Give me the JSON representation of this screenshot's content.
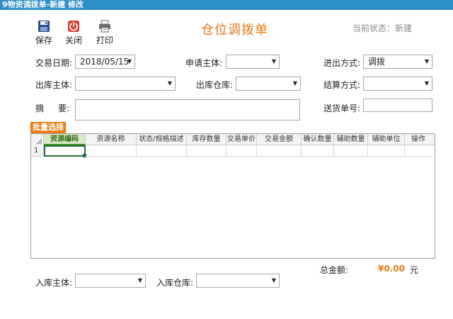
{
  "window": {
    "title": "9物资调拨单-新建 修改"
  },
  "toolbar": {
    "save_label": "保存",
    "close_label": "关闭",
    "print_label": "打印",
    "colors": {
      "save": "#2b4f8f",
      "close": "#e03c2c",
      "print": "#6b6b6b"
    }
  },
  "page": {
    "title": "仓位调拨单"
  },
  "status": {
    "label": "当前状态：",
    "value": "新建"
  },
  "form": {
    "trade_date": {
      "label": "交易日期:",
      "value": "2018/05/15"
    },
    "applicant": {
      "label": "申请主体:",
      "value": ""
    },
    "io_method": {
      "label": "进出方式:",
      "value": "调拨"
    },
    "out_entity": {
      "label": "出库主体:",
      "value": ""
    },
    "out_warehouse": {
      "label": "出库仓库:",
      "value": ""
    },
    "settle_method": {
      "label": "结算方式:",
      "value": ""
    },
    "summary": {
      "label_a": "摘",
      "label_b": "要:",
      "value": ""
    },
    "delivery_no": {
      "label": "送货单号:",
      "value": ""
    },
    "in_entity": {
      "label": "入库主体:",
      "value": ""
    },
    "in_warehouse": {
      "label": "入库仓库:",
      "value": ""
    }
  },
  "batch": {
    "tab_label": "批量选择"
  },
  "grid": {
    "columns": [
      "资源编码",
      "资源名称",
      "状态/规格描述",
      "库存数量",
      "交易单价",
      "交易金额",
      "确认数量",
      "辅助数量",
      "辅助单位",
      "操作"
    ],
    "rows": [
      {
        "index": "1"
      }
    ]
  },
  "total": {
    "label": "总金额:",
    "value": "¥0.00",
    "unit": "元"
  },
  "accent_color": "#f07b12",
  "titlebar_color": "#2c8fc7"
}
